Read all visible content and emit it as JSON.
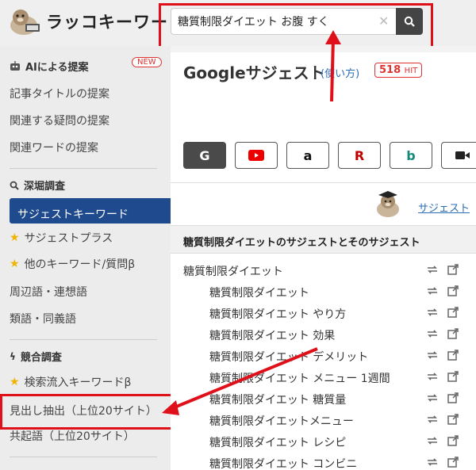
{
  "app": {
    "logo_text": "ラッコキーワード"
  },
  "search": {
    "value": "糖質制限ダイエット お腹 すく",
    "clear_glyph": "✕"
  },
  "sidebar": {
    "ai_section": "AIによる提案",
    "new_badge": "NEW",
    "ai_items": [
      "記事タイトルの提案",
      "関連する疑問の提案",
      "関連ワードの提案"
    ],
    "research_section": "深堀調査",
    "research_items": [
      {
        "label": "サジェストキーワード",
        "active": true,
        "star": false
      },
      {
        "label": "サジェストプラス",
        "active": false,
        "star": true
      },
      {
        "label": "他のキーワード/質問β",
        "active": false,
        "star": true
      },
      {
        "label": "周辺語・連想語",
        "active": false,
        "star": false
      },
      {
        "label": "類語・同義語",
        "active": false,
        "star": false
      }
    ],
    "competitor_section": "競合調査",
    "competitor_items": [
      {
        "label": "検索流入キーワードβ",
        "star": true
      },
      {
        "label": "見出し抽出（上位20サイト）",
        "star": false
      },
      {
        "label": "共起語（上位20サイト）",
        "star": false
      }
    ]
  },
  "main": {
    "title": "Googleサジェスト",
    "how_link": "(使い方)",
    "hit_count": "518",
    "hit_unit": "HIT",
    "engines": [
      "google",
      "youtube",
      "amazon",
      "rakuten",
      "bing",
      "video"
    ],
    "guide_link": "サジェスト",
    "table_header": "糖質制限ダイエットのサジェストとそのサジェスト",
    "rows": [
      {
        "text": "糖質制限ダイエット",
        "indent": 0
      },
      {
        "text": "糖質制限ダイエット",
        "indent": 1
      },
      {
        "text": "糖質制限ダイエット やり方",
        "indent": 1
      },
      {
        "text": "糖質制限ダイエット 効果",
        "indent": 1
      },
      {
        "text": "糖質制限ダイエット デメリット",
        "indent": 1
      },
      {
        "text": "糖質制限ダイエット メニュー 1週間",
        "indent": 1
      },
      {
        "text": "糖質制限ダイエット 糖質量",
        "indent": 1
      },
      {
        "text": "糖質制限ダイエットメニュー",
        "indent": 1
      },
      {
        "text": "糖質制限ダイエット レシピ",
        "indent": 1
      },
      {
        "text": "糖質制限ダイエット コンビニ",
        "indent": 1
      }
    ]
  },
  "colors": {
    "accent": "#1f4b8e",
    "highlight": "#e0101a",
    "star": "#f0b400"
  }
}
